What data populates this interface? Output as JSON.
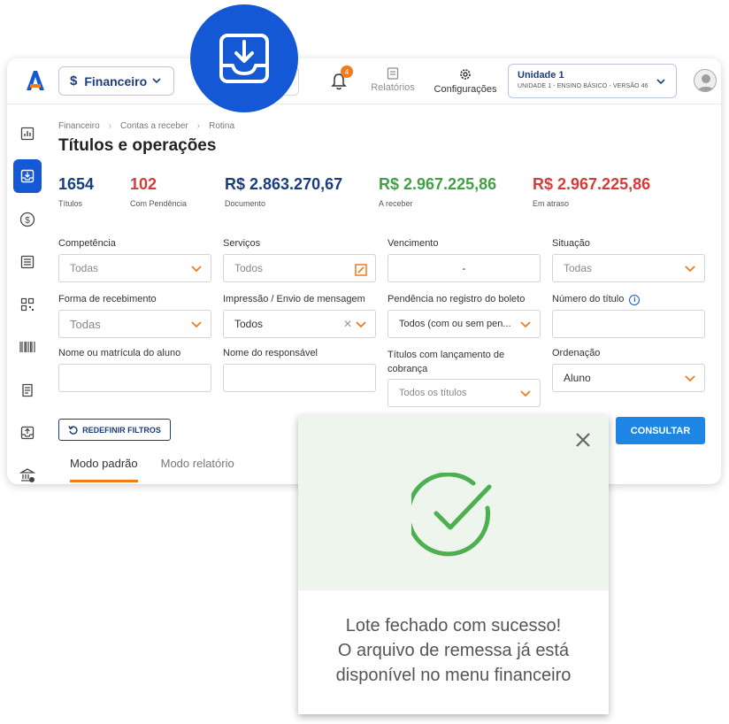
{
  "header": {
    "module": "Financeiro",
    "notifications_count": "4",
    "reports_label": "Relatórios",
    "config_label": "Configurações",
    "unit_name": "Unidade 1",
    "unit_sub": "UNIDADE 1 - ENSINO BÁSICO - VERSÃO 46"
  },
  "breadcrumb": [
    "Financeiro",
    "Contas a receber",
    "Rotina"
  ],
  "page_title": "Títulos e operações",
  "stats": [
    {
      "value": "1654",
      "label": "Títulos",
      "color": "#1a3d7c"
    },
    {
      "value": "102",
      "label": "Com Pendência",
      "color": "#d63b3b"
    },
    {
      "value": "R$ 2.863.270,67",
      "label": "Documento",
      "color": "#1a3d7c"
    },
    {
      "value": "R$ 2.967.225,86",
      "label": "A receber",
      "color": "#43a047"
    },
    {
      "value": "R$ 2.967.225,86",
      "label": "Em atraso",
      "color": "#d63b3b"
    }
  ],
  "filters": {
    "competencia": {
      "label": "Competência",
      "value": "Todas"
    },
    "servicos": {
      "label": "Serviços",
      "value": "Todos"
    },
    "vencimento": {
      "label": "Vencimento",
      "value": "-"
    },
    "situacao": {
      "label": "Situação",
      "value": "Todas"
    },
    "forma": {
      "label": "Forma de recebimento",
      "value": "Todas"
    },
    "impressao": {
      "label": "Impressão / Envio de mensagem",
      "value": "Todos"
    },
    "pendencia": {
      "label": "Pendência no registro do boleto",
      "value": "Todos (com ou sem pen..."
    },
    "numero": {
      "label": "Número do título",
      "value": ""
    },
    "nome_aluno": {
      "label": "Nome ou matrícula do aluno",
      "value": ""
    },
    "nome_resp": {
      "label": "Nome do responsável",
      "value": ""
    },
    "lancamento": {
      "label_line1": "Títulos com lançamento de",
      "label_line2": "cobrança",
      "value": "Todos os títulos"
    },
    "ordenacao": {
      "label": "Ordenação",
      "value": "Aluno"
    }
  },
  "buttons": {
    "reset": "REDEFINIR FILTROS",
    "consult": "CONSULTAR"
  },
  "tabs": [
    "Modo padrão",
    "Modo relatório"
  ],
  "modal": {
    "line1": "Lote fechado com sucesso!",
    "line2": "O arquivo de remessa já está",
    "line3": "disponível no menu financeiro"
  },
  "colors": {
    "primary": "#1558d6",
    "navy": "#1a3d7c",
    "accent": "#f07c1b",
    "success": "#43a047"
  }
}
